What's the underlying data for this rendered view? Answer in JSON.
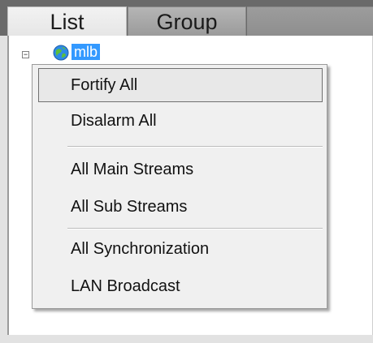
{
  "tabs": [
    {
      "label": "List"
    },
    {
      "label": "Group"
    }
  ],
  "tree": {
    "root": {
      "label": "mlb",
      "icon": "globe-icon"
    }
  },
  "context_menu": {
    "items": [
      {
        "label": "Fortify All"
      },
      {
        "label": "Disalarm All"
      },
      {
        "label": "All Main Streams"
      },
      {
        "label": "All Sub Streams"
      },
      {
        "label": "All Synchronization"
      },
      {
        "label": "LAN Broadcast"
      }
    ]
  },
  "colors": {
    "selection": "#3399ff",
    "menu_background": "#f0f0f0",
    "tab_active": "#eeeeee",
    "tab_inactive": "#a8a8a8"
  }
}
